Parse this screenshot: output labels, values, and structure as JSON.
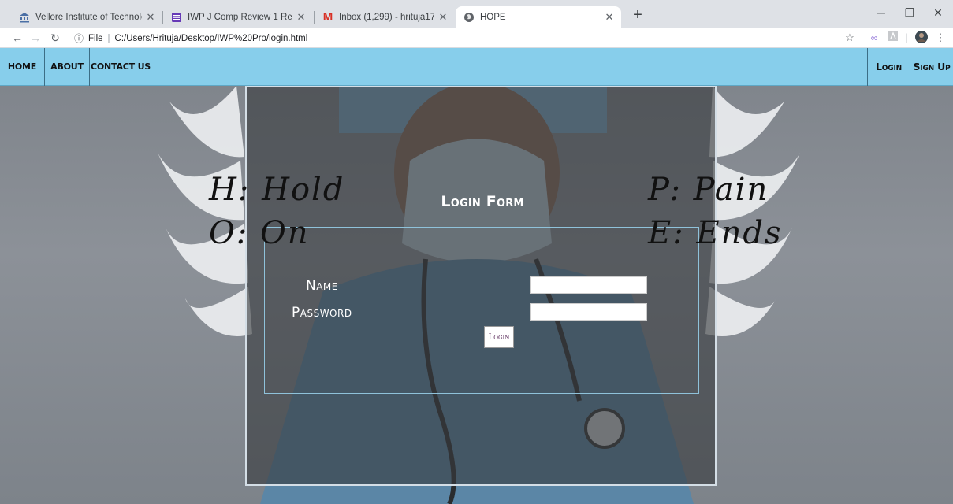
{
  "browser": {
    "tabs": [
      {
        "title": "Vellore Institute of Technology (V",
        "icon": "institution-icon",
        "active": false
      },
      {
        "title": "IWP J Comp Review 1 Report",
        "icon": "forms-icon",
        "active": false
      },
      {
        "title": "Inbox (1,299) - hrituja17.hs@gm",
        "icon": "gmail-icon",
        "active": false
      },
      {
        "title": "HOPE",
        "icon": "globe-icon",
        "active": true
      }
    ],
    "new_tab_label": "+",
    "address": {
      "scheme_label": "File",
      "path": "C:/Users/Hrituja/Desktop/IWP%20Pro/login.html"
    }
  },
  "nav": {
    "left": [
      "HOME",
      "ABOUT",
      "CONTACT US"
    ],
    "right": [
      "Login",
      "Sign Up"
    ]
  },
  "hero": {
    "left_lines": [
      "H: Hold",
      "O: On"
    ],
    "right_lines": [
      "P: Pain",
      "E: Ends"
    ]
  },
  "form": {
    "title": "Login Form",
    "name_label": "Name",
    "password_label": "Password",
    "name_value": "",
    "password_value": "",
    "submit_label": "Login"
  },
  "colors": {
    "navbar": "#87ceeb",
    "card_overlay": "rgba(55,58,62,0.62)",
    "form_border": "#8fc2da"
  }
}
